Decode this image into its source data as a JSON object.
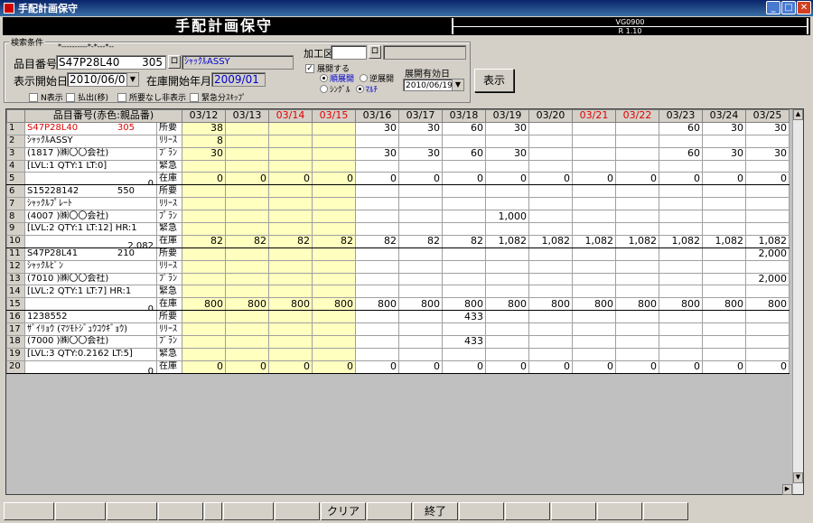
{
  "window": {
    "title": "手配計画保守"
  },
  "banner": {
    "title": "手配計画保守",
    "version_top": "VG0900",
    "version_bottom": "R 1.10"
  },
  "search": {
    "group_label": "検索条件",
    "part_label": "品目番号",
    "part_ruler": "*----------*-*---*--",
    "part_value": "S47P28L40",
    "part_suffix": "305",
    "part_btn": "ロ",
    "part_name": "ｼｬｯｸﾙASSY",
    "start_date_label": "表示開始日",
    "start_date_value": "2010/06/01",
    "stock_month_label": "在庫開始年月",
    "stock_month_value": "2009/01",
    "work_area_label": "加工区",
    "work_area_btn": "ロ",
    "expand_label": "展開する",
    "expand_checked": "✓",
    "radio_forward": "順展開",
    "radio_reverse": "逆展開",
    "radio_single": "ｼﾝｸﾞﾙ",
    "radio_multi": "ﾏﾙﾁ",
    "expand_date_label": "展開有効日",
    "expand_date_value": "2010/06/19",
    "cb_n": "N表示",
    "cb_payout": "払出(移)",
    "cb_noreq": "所要なし非表示",
    "cb_urgent": "緊急分ｽｷｯﾌﾟ"
  },
  "show_button": "表示",
  "grid": {
    "header_item": "品目番号(赤色:親品番)",
    "dates": [
      "03/12",
      "03/13",
      "03/14",
      "03/15",
      "03/16",
      "03/17",
      "03/18",
      "03/19",
      "03/20",
      "03/21",
      "03/22",
      "03/23",
      "03/24",
      "03/25"
    ],
    "red_dates": [
      2,
      3,
      9,
      10
    ],
    "rows": [
      {
        "n": "1",
        "info": "S47P28L40",
        "info2": "305",
        "red": true,
        "kind": "所要",
        "vals": [
          "38",
          "",
          "",
          "",
          "30",
          "30",
          "60",
          "30",
          "",
          "",
          "",
          "60",
          "30",
          "30"
        ]
      },
      {
        "n": "2",
        "info": "ｼｬｯｸﾙASSY",
        "info2": "",
        "kind": "ﾘﾘｰｽ",
        "vals": [
          "8",
          "",
          "",
          "",
          "",
          "",
          "",
          "",
          "",
          "",
          "",
          "",
          "",
          ""
        ]
      },
      {
        "n": "3",
        "info": "(1817  )㈱〇〇会社)",
        "info2": "",
        "kind": "ﾌﾟﾗﾝ",
        "vals": [
          "30",
          "",
          "",
          "",
          "30",
          "30",
          "60",
          "30",
          "",
          "",
          "",
          "60",
          "30",
          "30"
        ]
      },
      {
        "n": "4",
        "info": "[LVL:1 QTY:1 LT:0]",
        "info2": "",
        "kind": "緊急",
        "vals": [
          "",
          "",
          "",
          "",
          "",
          "",
          "",
          "",
          "",
          "",
          "",
          "",
          "",
          ""
        ]
      },
      {
        "n": "5",
        "info": "",
        "info2": "0",
        "kind": "在庫",
        "vals": [
          "0",
          "0",
          "0",
          "0",
          "0",
          "0",
          "0",
          "0",
          "0",
          "0",
          "0",
          "0",
          "0",
          "0"
        ]
      },
      {
        "n": "6",
        "info": "S15228142",
        "info2": "550",
        "kind": "所要",
        "vals": [
          "",
          "",
          "",
          "",
          "",
          "",
          "",
          "",
          "",
          "",
          "",
          "",
          "",
          ""
        ]
      },
      {
        "n": "7",
        "info": "ｼｬｯｸﾙﾌﾟﾚｰﾄ",
        "info2": "",
        "kind": "ﾘﾘｰｽ",
        "vals": [
          "",
          "",
          "",
          "",
          "",
          "",
          "",
          "",
          "",
          "",
          "",
          "",
          "",
          ""
        ]
      },
      {
        "n": "8",
        "info": "(4007  )㈱〇〇会社)",
        "info2": "",
        "kind": "ﾌﾟﾗﾝ",
        "vals": [
          "",
          "",
          "",
          "",
          "",
          "",
          "",
          "1,000",
          "",
          "",
          "",
          "",
          "",
          ""
        ]
      },
      {
        "n": "9",
        "info": "[LVL:2 QTY:1 LT:12] HR:1",
        "info2": "",
        "kind": "緊急",
        "vals": [
          "",
          "",
          "",
          "",
          "",
          "",
          "",
          "",
          "",
          "",
          "",
          "",
          "",
          ""
        ]
      },
      {
        "n": "10",
        "info": "",
        "info2": "2,082",
        "kind": "在庫",
        "vals": [
          "82",
          "82",
          "82",
          "82",
          "82",
          "82",
          "82",
          "1,082",
          "1,082",
          "1,082",
          "1,082",
          "1,082",
          "1,082",
          "1,082"
        ]
      },
      {
        "n": "11",
        "info": "S47P28L41",
        "info2": "210",
        "kind": "所要",
        "vals": [
          "",
          "",
          "",
          "",
          "",
          "",
          "",
          "",
          "",
          "",
          "",
          "",
          "",
          "2,000"
        ]
      },
      {
        "n": "12",
        "info": "ｼｬｯｸﾙﾋﾟﾝ",
        "info2": "",
        "kind": "ﾘﾘｰｽ",
        "vals": [
          "",
          "",
          "",
          "",
          "",
          "",
          "",
          "",
          "",
          "",
          "",
          "",
          "",
          ""
        ]
      },
      {
        "n": "13",
        "info": "(7010  )㈱〇〇会社)",
        "info2": "",
        "kind": "ﾌﾟﾗﾝ",
        "vals": [
          "",
          "",
          "",
          "",
          "",
          "",
          "",
          "",
          "",
          "",
          "",
          "",
          "",
          "2,000"
        ]
      },
      {
        "n": "14",
        "info": "[LVL:2 QTY:1 LT:7] HR:1",
        "info2": "",
        "kind": "緊急",
        "vals": [
          "",
          "",
          "",
          "",
          "",
          "",
          "",
          "",
          "",
          "",
          "",
          "",
          "",
          ""
        ]
      },
      {
        "n": "15",
        "info": "",
        "info2": "0",
        "kind": "在庫",
        "vals": [
          "800",
          "800",
          "800",
          "800",
          "800",
          "800",
          "800",
          "800",
          "800",
          "800",
          "800",
          "800",
          "800",
          "800"
        ]
      },
      {
        "n": "16",
        "info": "1238552",
        "info2": "",
        "kind": "所要",
        "vals": [
          "",
          "",
          "",
          "",
          "",
          "",
          "433",
          "",
          "",
          "",
          "",
          "",
          "",
          ""
        ]
      },
      {
        "n": "17",
        "info": "ｻﾞｲﾘｮｳ (ﾏﾂﾓﾄｼﾞｭｳｺｳｷﾞｮｳ)",
        "info2": "",
        "kind": "ﾘﾘｰｽ",
        "vals": [
          "",
          "",
          "",
          "",
          "",
          "",
          "",
          "",
          "",
          "",
          "",
          "",
          "",
          ""
        ]
      },
      {
        "n": "18",
        "info": "(7000  )㈱〇〇会社)",
        "info2": "",
        "kind": "ﾌﾟﾗﾝ",
        "vals": [
          "",
          "",
          "",
          "",
          "",
          "",
          "433",
          "",
          "",
          "",
          "",
          "",
          "",
          ""
        ]
      },
      {
        "n": "19",
        "info": "[LVL:3 QTY:0.2162 LT:5]",
        "info2": "",
        "kind": "緊急",
        "vals": [
          "",
          "",
          "",
          "",
          "",
          "",
          "",
          "",
          "",
          "",
          "",
          "",
          "",
          ""
        ]
      },
      {
        "n": "20",
        "info": "",
        "info2": "0",
        "kind": "在庫",
        "vals": [
          "0",
          "0",
          "0",
          "0",
          "0",
          "0",
          "0",
          "0",
          "0",
          "0",
          "0",
          "0",
          "0",
          "0"
        ]
      }
    ]
  },
  "fkeys": [
    "",
    "",
    "",
    "",
    "",
    "",
    "",
    "クリア",
    "",
    "終了",
    "",
    "",
    "",
    "",
    ""
  ]
}
